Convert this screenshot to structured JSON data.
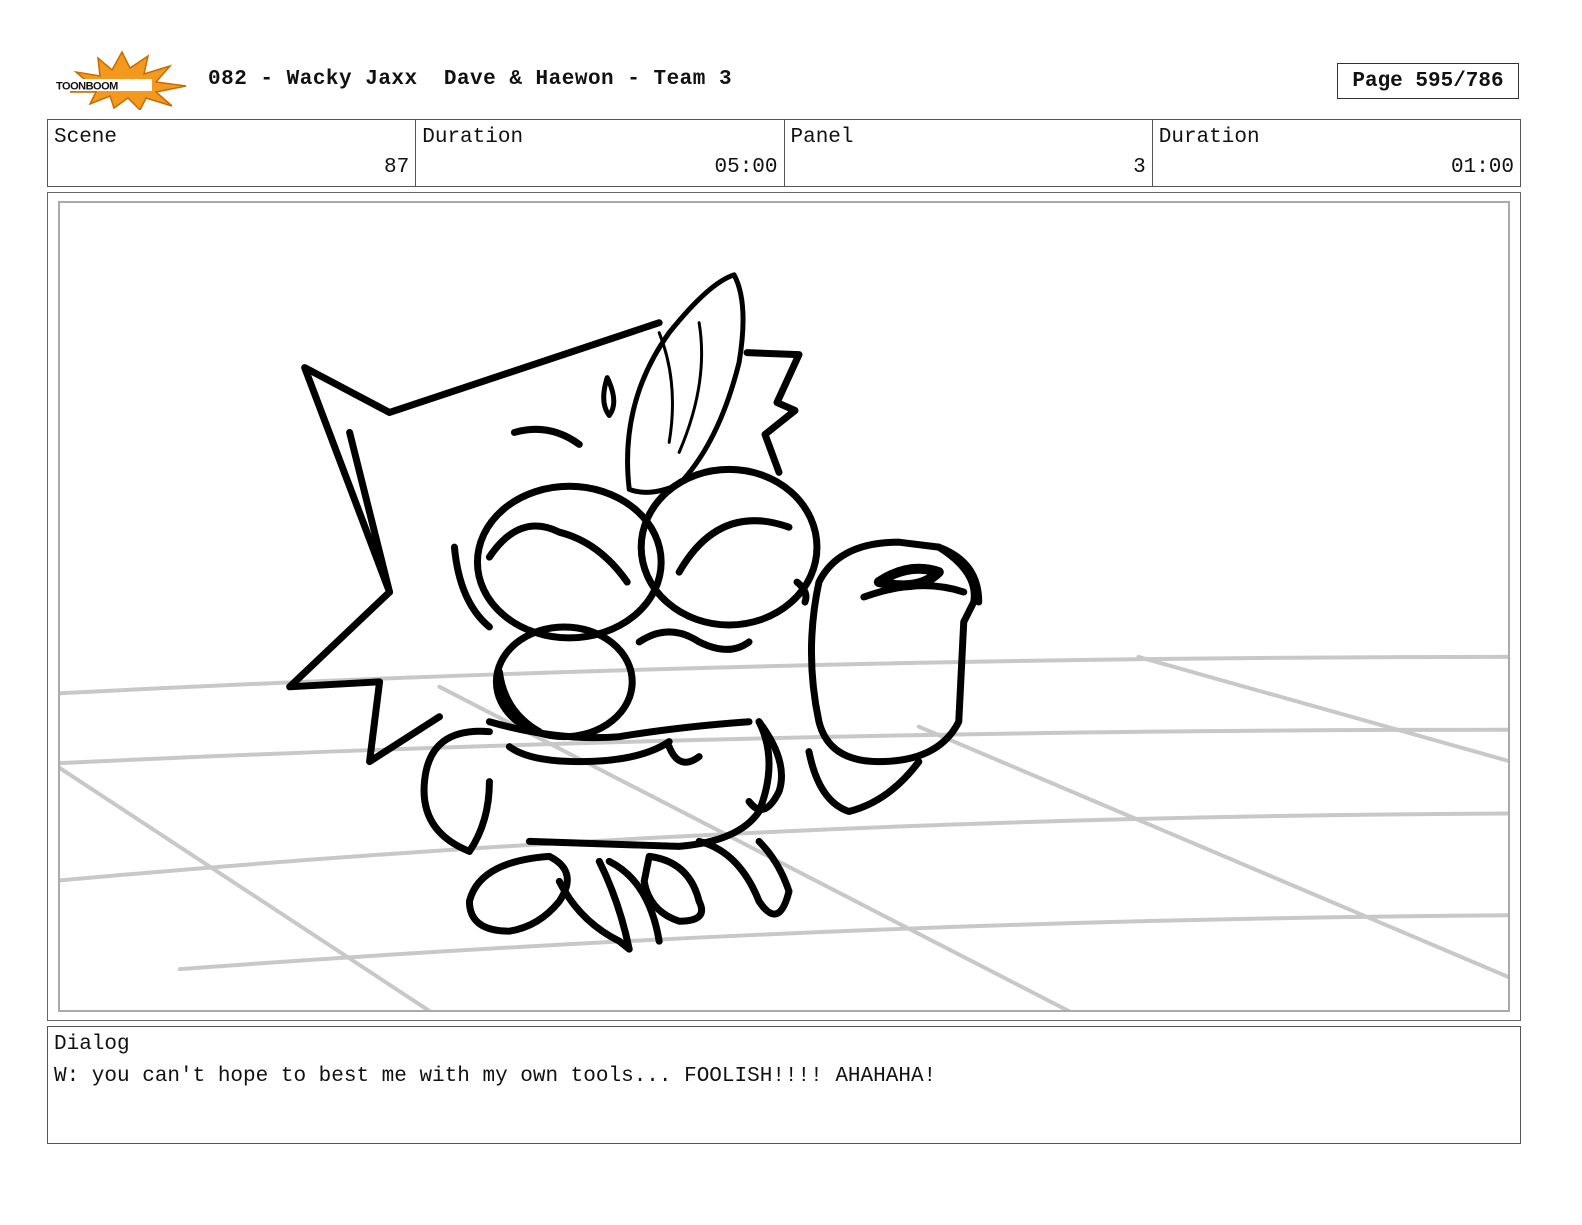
{
  "header": {
    "logo_text": "TOONBOOM",
    "title": "082 - Wacky Jaxx  Dave & Haewon - Team 3",
    "page_label": "Page 595/786"
  },
  "info": {
    "scene_label": "Scene",
    "scene_value": "87",
    "scene_duration_label": "Duration",
    "scene_duration_value": "05:00",
    "panel_label": "Panel",
    "panel_value": "3",
    "panel_duration_label": "Duration",
    "panel_duration_value": "01:00"
  },
  "dialog": {
    "label": "Dialog",
    "text": "W: you can't hope to best me with my own tools... FOOLISH!!!! AHAHAHA!"
  },
  "colors": {
    "logo_burst": "#f39a1e",
    "logo_black": "#111111",
    "floor_lines": "#c8c8c8",
    "sketch_lines": "#000000"
  }
}
